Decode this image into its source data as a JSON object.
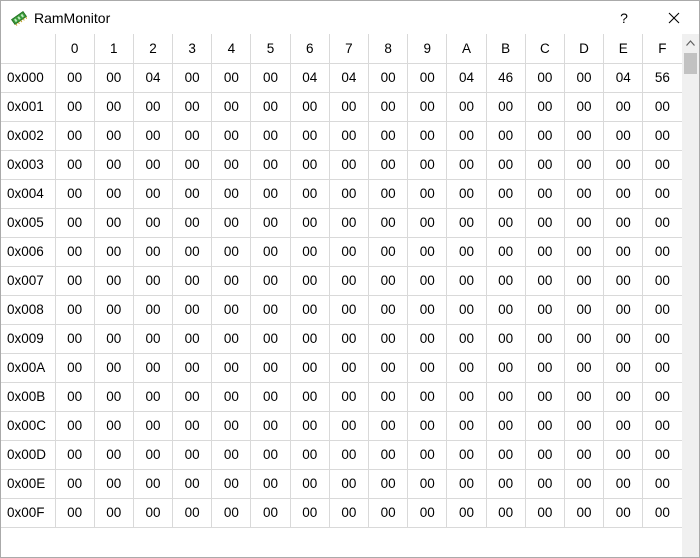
{
  "window": {
    "title": "RamMonitor",
    "help_label": "?"
  },
  "table": {
    "columns": [
      "0",
      "1",
      "2",
      "3",
      "4",
      "5",
      "6",
      "7",
      "8",
      "9",
      "A",
      "B",
      "C",
      "D",
      "E",
      "F"
    ],
    "rows": [
      {
        "address": "0x000",
        "values": [
          "00",
          "00",
          "04",
          "00",
          "00",
          "00",
          "04",
          "04",
          "00",
          "00",
          "04",
          "46",
          "00",
          "00",
          "04",
          "56"
        ]
      },
      {
        "address": "0x001",
        "values": [
          "00",
          "00",
          "00",
          "00",
          "00",
          "00",
          "00",
          "00",
          "00",
          "00",
          "00",
          "00",
          "00",
          "00",
          "00",
          "00"
        ]
      },
      {
        "address": "0x002",
        "values": [
          "00",
          "00",
          "00",
          "00",
          "00",
          "00",
          "00",
          "00",
          "00",
          "00",
          "00",
          "00",
          "00",
          "00",
          "00",
          "00"
        ]
      },
      {
        "address": "0x003",
        "values": [
          "00",
          "00",
          "00",
          "00",
          "00",
          "00",
          "00",
          "00",
          "00",
          "00",
          "00",
          "00",
          "00",
          "00",
          "00",
          "00"
        ]
      },
      {
        "address": "0x004",
        "values": [
          "00",
          "00",
          "00",
          "00",
          "00",
          "00",
          "00",
          "00",
          "00",
          "00",
          "00",
          "00",
          "00",
          "00",
          "00",
          "00"
        ]
      },
      {
        "address": "0x005",
        "values": [
          "00",
          "00",
          "00",
          "00",
          "00",
          "00",
          "00",
          "00",
          "00",
          "00",
          "00",
          "00",
          "00",
          "00",
          "00",
          "00"
        ]
      },
      {
        "address": "0x006",
        "values": [
          "00",
          "00",
          "00",
          "00",
          "00",
          "00",
          "00",
          "00",
          "00",
          "00",
          "00",
          "00",
          "00",
          "00",
          "00",
          "00"
        ]
      },
      {
        "address": "0x007",
        "values": [
          "00",
          "00",
          "00",
          "00",
          "00",
          "00",
          "00",
          "00",
          "00",
          "00",
          "00",
          "00",
          "00",
          "00",
          "00",
          "00"
        ]
      },
      {
        "address": "0x008",
        "values": [
          "00",
          "00",
          "00",
          "00",
          "00",
          "00",
          "00",
          "00",
          "00",
          "00",
          "00",
          "00",
          "00",
          "00",
          "00",
          "00"
        ]
      },
      {
        "address": "0x009",
        "values": [
          "00",
          "00",
          "00",
          "00",
          "00",
          "00",
          "00",
          "00",
          "00",
          "00",
          "00",
          "00",
          "00",
          "00",
          "00",
          "00"
        ]
      },
      {
        "address": "0x00A",
        "values": [
          "00",
          "00",
          "00",
          "00",
          "00",
          "00",
          "00",
          "00",
          "00",
          "00",
          "00",
          "00",
          "00",
          "00",
          "00",
          "00"
        ]
      },
      {
        "address": "0x00B",
        "values": [
          "00",
          "00",
          "00",
          "00",
          "00",
          "00",
          "00",
          "00",
          "00",
          "00",
          "00",
          "00",
          "00",
          "00",
          "00",
          "00"
        ]
      },
      {
        "address": "0x00C",
        "values": [
          "00",
          "00",
          "00",
          "00",
          "00",
          "00",
          "00",
          "00",
          "00",
          "00",
          "00",
          "00",
          "00",
          "00",
          "00",
          "00"
        ]
      },
      {
        "address": "0x00D",
        "values": [
          "00",
          "00",
          "00",
          "00",
          "00",
          "00",
          "00",
          "00",
          "00",
          "00",
          "00",
          "00",
          "00",
          "00",
          "00",
          "00"
        ]
      },
      {
        "address": "0x00E",
        "values": [
          "00",
          "00",
          "00",
          "00",
          "00",
          "00",
          "00",
          "00",
          "00",
          "00",
          "00",
          "00",
          "00",
          "00",
          "00",
          "00"
        ]
      },
      {
        "address": "0x00F",
        "values": [
          "00",
          "00",
          "00",
          "00",
          "00",
          "00",
          "00",
          "00",
          "00",
          "00",
          "00",
          "00",
          "00",
          "00",
          "00",
          "00"
        ]
      }
    ]
  },
  "icons": {
    "app": "ram-chip-icon",
    "close": "close-icon",
    "scroll_up": "chevron-up-icon"
  },
  "colors": {
    "app_icon_green": "#3a9a3a",
    "grid_line": "#d9d9d9",
    "scrollbar_track": "#f0f0f0",
    "scrollbar_thumb": "#c2c2c2"
  }
}
